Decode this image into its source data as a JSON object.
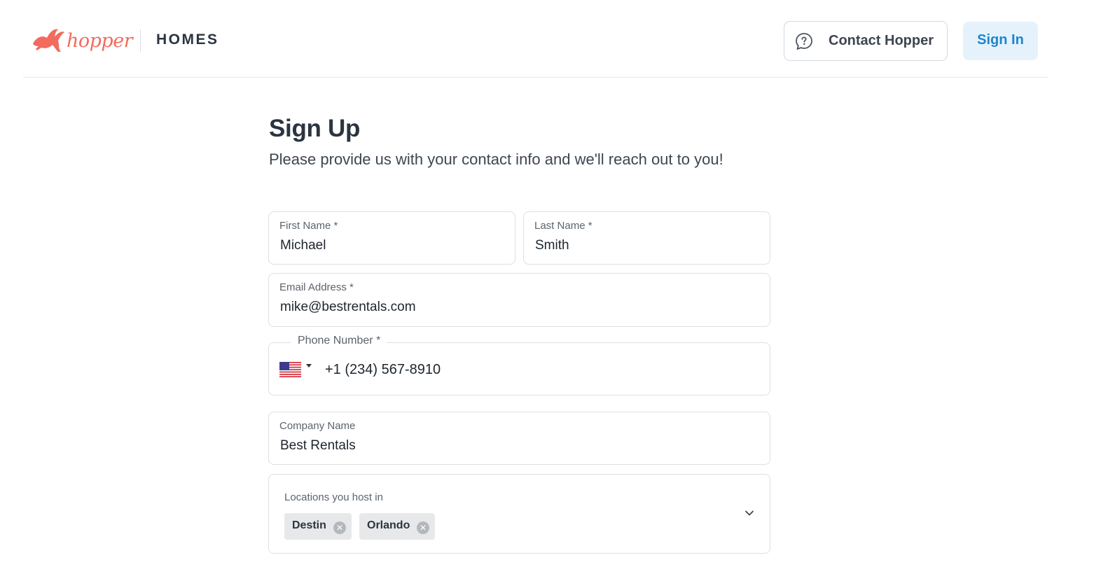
{
  "header": {
    "logo_text": "hopper",
    "logo_suffix": "HOMES",
    "contact_label": "Contact Hopper",
    "contact_icon": "chat-question-icon",
    "signin_label": "Sign In"
  },
  "page": {
    "title": "Sign Up",
    "subtitle": "Please provide us with your contact info and we'll reach out to you!"
  },
  "form": {
    "first_name": {
      "label": "First Name *",
      "value": "Michael"
    },
    "last_name": {
      "label": "Last Name *",
      "value": "Smith"
    },
    "email": {
      "label": "Email Address *",
      "value": "mike@bestrentals.com"
    },
    "phone": {
      "label": "Phone Number *",
      "country_icon": "us-flag-icon",
      "value": "+1 (234) 567-8910"
    },
    "company": {
      "label": "Company Name",
      "value": "Best Rentals"
    },
    "locations": {
      "label": "Locations you host in",
      "chips": [
        "Destin",
        "Orlando"
      ]
    }
  },
  "colors": {
    "brand_coral": "#f26b5e",
    "link_blue": "#1c86d1",
    "signin_bg": "#e6f2fb",
    "text_dark": "#2b3440"
  }
}
